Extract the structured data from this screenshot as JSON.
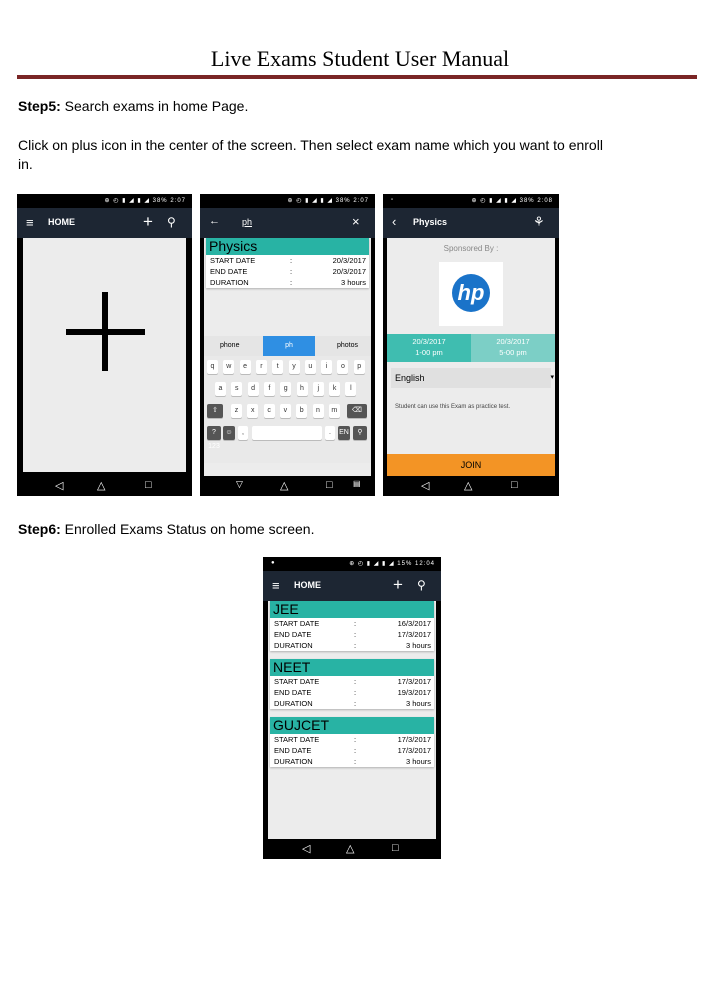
{
  "document": {
    "title": "Live Exams Student User Manual",
    "step5_label": "Step5:",
    "step5_text": " Search exams in home Page.",
    "instruction_line1": "Click on plus icon in the center of the screen. Then select exam name which you want to enroll",
    "instruction_line2": "in.",
    "step6_label": "Step6:",
    "step6_text": " Enrolled Exams Status on home screen.",
    "title_rule_color": "#7a2525"
  },
  "colors": {
    "appbar": "#1d2633",
    "card_head": "#28b3a4",
    "join": "#f39425",
    "date_left": "#3fbdb0",
    "date_right": "#7ccfc6"
  },
  "status_bar": {
    "icons": "⊕ ◴ ▮ ◢ ▮ ◢",
    "battery_a": "38%",
    "time_a": "2:07",
    "battery_b": "38%",
    "time_b": "2:08",
    "battery_c": "15%",
    "time_c": "12:04"
  },
  "phone1": {
    "title": "HOME",
    "menu_icon": "hamburger-icon",
    "center_icon": "plus-icon"
  },
  "phone2": {
    "search_text": "ph",
    "close": "×",
    "back": "←",
    "card": {
      "name": "Physics",
      "rows": [
        {
          "label": "START DATE",
          "sep": ":",
          "value": "20/3/2017"
        },
        {
          "label": "END DATE",
          "sep": ":",
          "value": "20/3/2017"
        },
        {
          "label": "DURATION",
          "sep": ":",
          "value": "3 hours"
        }
      ]
    },
    "suggestions": [
      "phone",
      "ph",
      "photos"
    ],
    "keys_row1": [
      "q",
      "w",
      "e",
      "r",
      "t",
      "y",
      "u",
      "i",
      "o",
      "p"
    ],
    "keys_row2": [
      "a",
      "s",
      "d",
      "f",
      "g",
      "h",
      "j",
      "k",
      "l"
    ],
    "keys_row3": [
      "z",
      "x",
      "c",
      "v",
      "b",
      "n",
      "m"
    ],
    "key_numbers": "?123",
    "key_comma": ",",
    "key_period": ".",
    "key_lang": "EN"
  },
  "phone3": {
    "title": "Physics",
    "sponsored": "Sponsored By :",
    "logo_text": "hp",
    "start_date": "20/3/2017",
    "start_time": "1-00 pm",
    "end_date": "20/3/2017",
    "end_time": "5-00 pm",
    "language": "English",
    "note": "Student can use this Exam as practice test.",
    "join": "JOIN"
  },
  "phone4": {
    "title": "HOME",
    "exams": [
      {
        "name": "JEE",
        "rows": [
          {
            "label": "START DATE",
            "sep": ":",
            "value": "16/3/2017"
          },
          {
            "label": "END DATE",
            "sep": ":",
            "value": "17/3/2017"
          },
          {
            "label": "DURATION",
            "sep": ":",
            "value": "3 hours"
          }
        ]
      },
      {
        "name": "NEET",
        "rows": [
          {
            "label": "START DATE",
            "sep": ":",
            "value": "17/3/2017"
          },
          {
            "label": "END DATE",
            "sep": ":",
            "value": "19/3/2017"
          },
          {
            "label": "DURATION",
            "sep": ":",
            "value": "3 hours"
          }
        ]
      },
      {
        "name": "GUJCET",
        "rows": [
          {
            "label": "START DATE",
            "sep": ":",
            "value": "17/3/2017"
          },
          {
            "label": "END DATE",
            "sep": ":",
            "value": "17/3/2017"
          },
          {
            "label": "DURATION",
            "sep": ":",
            "value": "3 hours"
          }
        ]
      }
    ]
  },
  "navbar": {
    "back": "◁",
    "home": "△",
    "recent": "□"
  }
}
